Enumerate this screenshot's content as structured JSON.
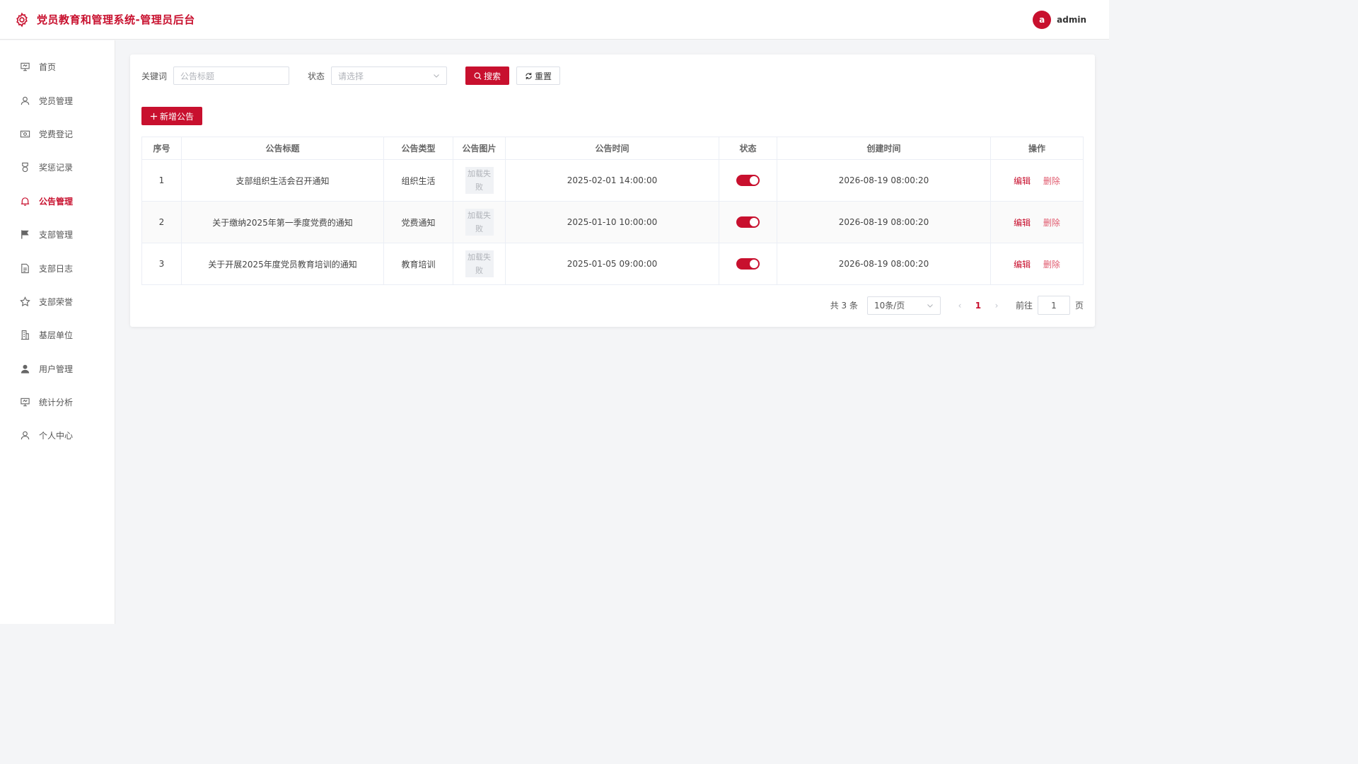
{
  "header": {
    "title": "党员教育和管理系统-管理员后台",
    "avatar_letter": "a",
    "username": "admin"
  },
  "sidebar": {
    "items": [
      {
        "label": "首页",
        "icon": "presentation-icon"
      },
      {
        "label": "党员管理",
        "icon": "user-icon"
      },
      {
        "label": "党费登记",
        "icon": "money-icon"
      },
      {
        "label": "奖惩记录",
        "icon": "medal-icon"
      },
      {
        "label": "公告管理",
        "icon": "bell-icon",
        "active": true
      },
      {
        "label": "支部管理",
        "icon": "flag-icon"
      },
      {
        "label": "支部日志",
        "icon": "document-icon"
      },
      {
        "label": "支部荣誉",
        "icon": "star-icon"
      },
      {
        "label": "基层单位",
        "icon": "building-icon"
      },
      {
        "label": "用户管理",
        "icon": "user-filled-icon"
      },
      {
        "label": "统计分析",
        "icon": "presentation-icon"
      },
      {
        "label": "个人中心",
        "icon": "user-icon"
      }
    ]
  },
  "filters": {
    "keyword_label": "关键词",
    "keyword_placeholder": "公告标题",
    "status_label": "状态",
    "status_placeholder": "请选择",
    "search_label": "搜索",
    "reset_label": "重置"
  },
  "add_button": "新增公告",
  "table": {
    "headers": [
      "序号",
      "公告标题",
      "公告类型",
      "公告图片",
      "公告时间",
      "状态",
      "创建时间",
      "操作"
    ],
    "rows": [
      {
        "index": "1",
        "title": "支部组织生活会召开通知",
        "type": "组织生活",
        "image": "加载失败",
        "time": "2025-02-01 14:00:00",
        "status_on": true,
        "created": "2026-08-19 08:00:20"
      },
      {
        "index": "2",
        "title": "关于缴纳2025年第一季度党费的通知",
        "type": "党费通知",
        "image": "加载失败",
        "time": "2025-01-10 10:00:00",
        "status_on": true,
        "created": "2026-08-19 08:00:20"
      },
      {
        "index": "3",
        "title": "关于开展2025年度党员教育培训的通知",
        "type": "教育培训",
        "image": "加载失败",
        "time": "2025-01-05 09:00:00",
        "status_on": true,
        "created": "2026-08-19 08:00:20"
      }
    ],
    "edit_label": "编辑",
    "delete_label": "删除"
  },
  "pagination": {
    "total_text": "共 3 条",
    "page_size": "10条/页",
    "current_page": "1",
    "goto_label": "前往",
    "goto_value": "1",
    "page_suffix": "页"
  },
  "colors": {
    "accent": "#c8102e"
  }
}
